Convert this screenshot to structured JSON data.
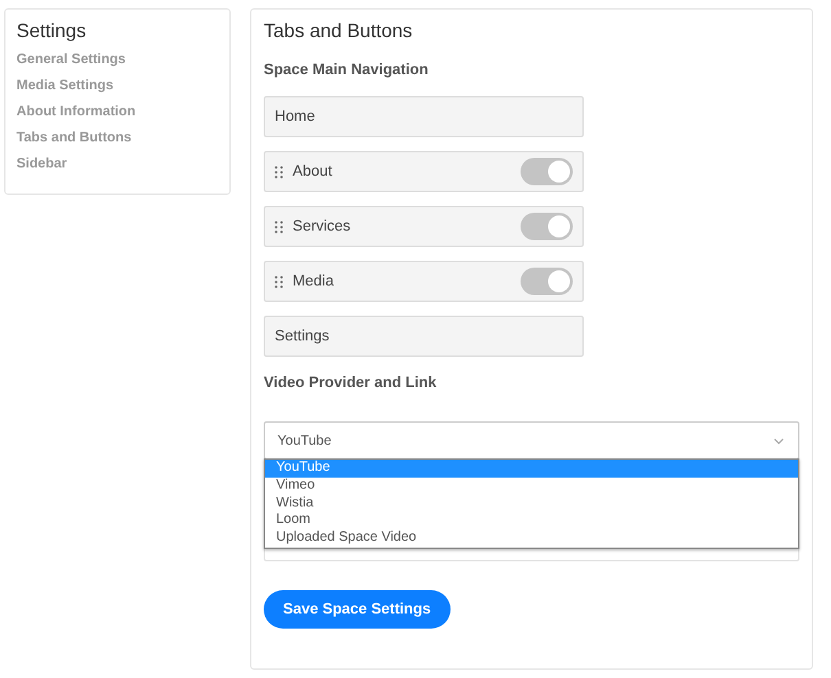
{
  "sidebar": {
    "title": "Settings",
    "items": [
      {
        "label": "General Settings"
      },
      {
        "label": "Media Settings"
      },
      {
        "label": "About Information"
      },
      {
        "label": "Tabs and Buttons"
      },
      {
        "label": "Sidebar"
      }
    ]
  },
  "main": {
    "title": "Tabs and Buttons",
    "navigation": {
      "heading": "Space Main Navigation",
      "items": [
        {
          "kind": "fixed",
          "label": "Home"
        },
        {
          "kind": "toggle",
          "label": "About",
          "on": true
        },
        {
          "kind": "toggle",
          "label": "Services",
          "on": true
        },
        {
          "kind": "toggle",
          "label": "Media",
          "on": true
        },
        {
          "kind": "fixed",
          "label": "Settings"
        }
      ]
    },
    "video": {
      "heading": "Video Provider and Link",
      "select_value": "YouTube",
      "options": [
        {
          "label": "YouTube",
          "selected": true
        },
        {
          "label": "Vimeo",
          "selected": false
        },
        {
          "label": "Wistia",
          "selected": false
        },
        {
          "label": "Loom",
          "selected": false
        },
        {
          "label": "Uploaded Space Video",
          "selected": false
        }
      ]
    },
    "save_button": "Save Space Settings"
  }
}
